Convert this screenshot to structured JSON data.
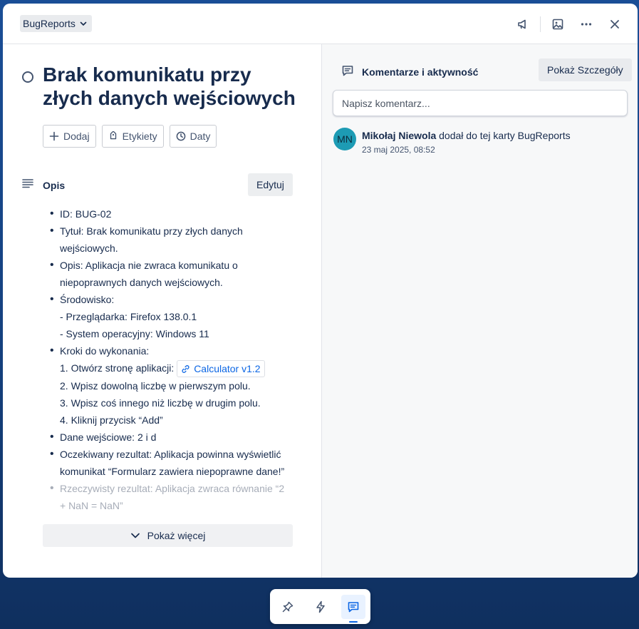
{
  "header": {
    "board_name": "BugReports"
  },
  "card": {
    "title": "Brak komunikatu przy złych danych wejściowych",
    "actions": {
      "add": "Dodaj",
      "labels": "Etykiety",
      "dates": "Daty"
    }
  },
  "description": {
    "heading": "Opis",
    "edit": "Edytuj",
    "id": "ID: BUG-02",
    "title_line": "Tytuł: Brak komunikatu przy złych danych wejściowych.",
    "desc_line": "Opis: Aplikacja nie zwraca komunikatu o niepoprawnych danych wejściowych.",
    "env_heading": "Środowisko:",
    "env_browser": "- Przeglądarka: Firefox 138.0.1",
    "env_os": "- System operacyjny: Windows 11",
    "steps_heading": "Kroki do wykonania:",
    "step1_prefix": "1. Otwórz stronę aplikacji:",
    "step1_link": "Calculator v1.2",
    "step2": "2. Wpisz dowolną liczbę w pierwszym polu.",
    "step3": "3. Wpisz coś innego niż liczbę w drugim polu.",
    "step4": "4. Kliknij przycisk “Add”",
    "input_data": "Dane wejściowe: 2 i d",
    "expected": "Oczekiwany rezultat: Aplikacja powinna wyświetlić komunikat “Formularz zawiera niepoprawne dane!”",
    "actual": "Rzeczywisty rezultat: Aplikacja zwraca równanie “2 + NaN = NaN”",
    "show_more": "Pokaż więcej"
  },
  "comments": {
    "heading": "Komentarze i aktywność",
    "details_button": "Pokaż Szczegóły",
    "input_placeholder": "Napisz komentarz...",
    "activity": {
      "avatar_initials": "MN",
      "user": "Mikołaj Niewola",
      "action": "dodał do tej karty BugReports",
      "time": "23 maj 2025, 08:52"
    }
  },
  "colors": {
    "accent": "#0c66e4",
    "avatar": "#1d9bb4"
  }
}
